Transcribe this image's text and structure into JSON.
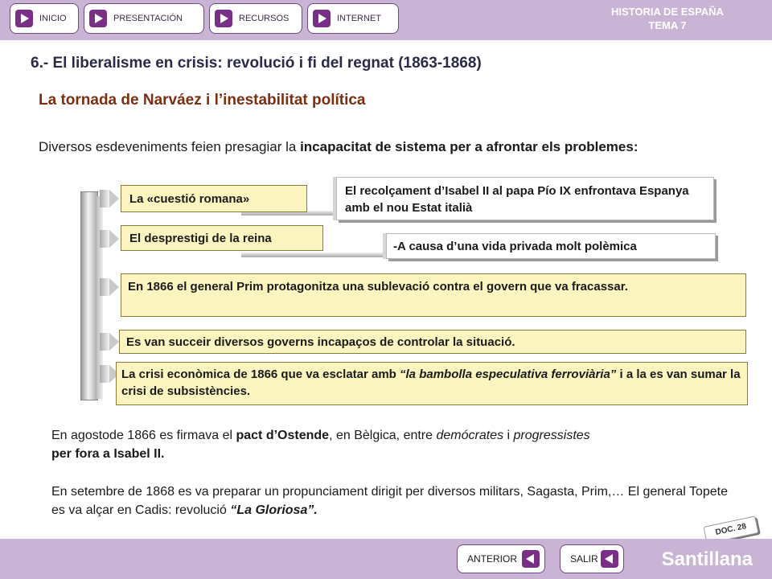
{
  "nav": {
    "items": [
      {
        "label": "INICIO"
      },
      {
        "label": "PRESENTACIÓN"
      },
      {
        "label": "RECURSOS"
      },
      {
        "label": "INTERNET"
      }
    ],
    "course_line1": "HISTORIA DE ESPAÑA",
    "course_line2": "TEMA 7"
  },
  "title": "6.- El liberalisme en crisis: revolució i fi del regnat (1863-1868)",
  "subtitle": "La tornada de Narváez i l’inestabilitat política",
  "intro": {
    "text_a": "Diversos esdeveniments feien presagiar la ",
    "text_b": "incapacitat de sistema per a afrontar els problemes:"
  },
  "diagram": {
    "item1": "La «cuestió romana»",
    "detail1": "El recolçament d’Isabel II al papa Pío IX enfrontava Espanya amb el nou Estat italià",
    "item2": "El desprestigi de la reina",
    "detail2": "-A causa d’una vida privada molt polèmica",
    "item3": "En 1866 el general Prim protagonitza una sublevació contra el govern que va fracassar.",
    "item4": "Es van succeir diversos governs incapaços de controlar la situació.",
    "item5_a": "La crisi econòmica de 1866 que va esclatar amb ",
    "item5_b": "“la bambolla especulativa ferroviària”",
    "item5_c": " i a la es van sumar la crisi de subsistències."
  },
  "para1": {
    "a": "En agostode 1866 es firmava el ",
    "b": "pact d’Ostende",
    "c": ", en Bèlgica, entre ",
    "d": "demócrates",
    "e": "  i ",
    "f": "progressistes",
    "g": "per fora a Isabel II."
  },
  "para2": {
    "a": "En setembre de 1868 es va preparar un propunciament dirigit per diversos militars, Sagasta, Prim,… El general Topete es va alçar en Cadis: revolució ",
    "b": "“La Gloriosa”."
  },
  "doc_badge": "DOC. 28",
  "footer": {
    "prev": "ANTERIOR",
    "exit": "SALIR",
    "brand": "Santillana"
  }
}
